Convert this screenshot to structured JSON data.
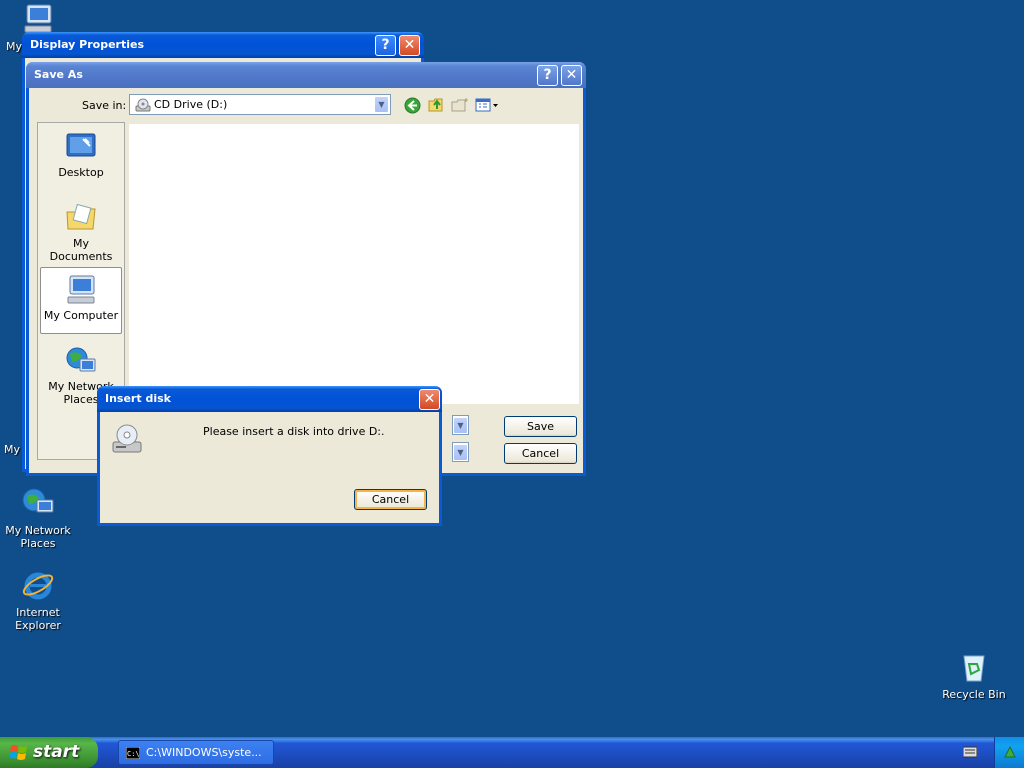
{
  "desktop": {
    "icons": [
      {
        "label": "My",
        "name": "my-computer"
      },
      {
        "label": "My Network Places",
        "name": "my-network-places"
      },
      {
        "label": "Internet Explorer",
        "name": "internet-explorer"
      },
      {
        "label": "Recycle Bin",
        "name": "recycle-bin"
      }
    ],
    "partial_label": "My I"
  },
  "display_properties": {
    "title": "Display Properties",
    "help_label": "?",
    "close_label": "✕"
  },
  "save_as": {
    "title": "Save As",
    "help_label": "?",
    "close_label": "✕",
    "save_in_label": "Save in:",
    "save_in_value": "CD Drive (D:)",
    "places": [
      {
        "label": "Desktop"
      },
      {
        "label": "My Documents"
      },
      {
        "label": "My Computer"
      },
      {
        "label": "My Network Places"
      }
    ],
    "save_button": "Save",
    "cancel_button": "Cancel"
  },
  "insert_disk": {
    "title": "Insert disk",
    "message": "Please insert a disk into drive D:.",
    "cancel_button": "Cancel",
    "close_label": "✕"
  },
  "taskbar": {
    "start_label": "start",
    "task_label": "C:\\WINDOWS\\syste..."
  },
  "colors": {
    "desktop": "#0f4e8b",
    "title_active": "#0052d8",
    "close_red": "#d24a23",
    "window_face": "#ece9d8"
  }
}
